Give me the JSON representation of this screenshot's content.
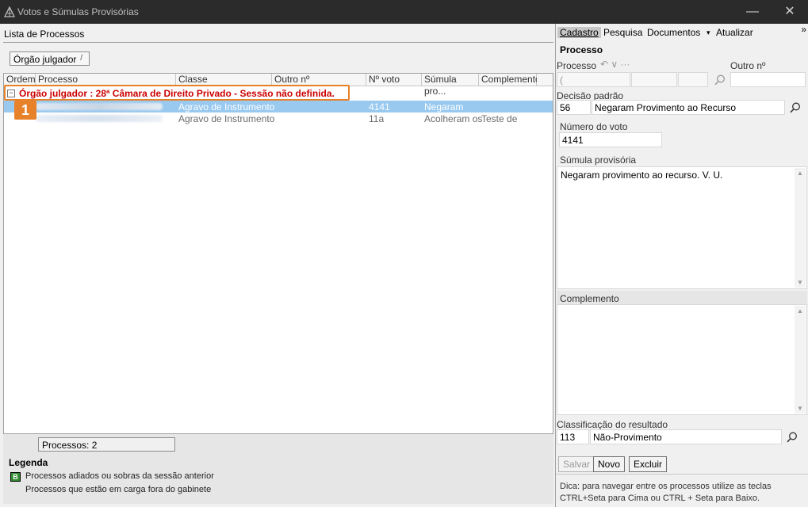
{
  "window": {
    "title": "Votos e Súmulas Provisórias",
    "minimize": "—",
    "close": "✕"
  },
  "left": {
    "panel_title": "Lista de Processos",
    "group_chip": "Órgão julgador",
    "group_chip_mark": "/",
    "columns": [
      "Ordem",
      "Processo",
      "Classe",
      "Outro nº",
      "Nº voto",
      "Súmula pro...",
      "Complemento"
    ],
    "group_toggle": "−",
    "group_label": "Órgão julgador : 28ª Câmara de Direito Privado - Sessão não definida.",
    "badge": "1",
    "rows": [
      {
        "classe": "Agravo de Instrumento",
        "voto": "4141",
        "sumula": "Negaram",
        "complemento": ""
      },
      {
        "classe": "Agravo de Instrumento",
        "voto": "11a",
        "sumula": "Acolheram os",
        "complemento": "Teste de"
      }
    ],
    "count": "Processos: 2",
    "legend": {
      "title": "Legenda",
      "icon_letter": "B",
      "item1": "Processos adiados ou sobras da sessão anterior",
      "item2": "Processos que estão em carga fora do gabinete"
    }
  },
  "right": {
    "menu": {
      "cadastro": "Cadastro",
      "pesquisa": "Pesquisa",
      "documentos": "Documentos",
      "documentos_arrow": "▾",
      "atualizar": "Atualizar",
      "more": "»"
    },
    "section_title": "Processo",
    "processo_label": "Processo",
    "processo_nav": "↶ ∨ ···",
    "processo_value": "(",
    "outro_label": "Outro nº",
    "decisao_label": "Decisão padrão",
    "decisao_code": "56",
    "decisao_text": "Negaram Provimento ao Recurso",
    "voto_label": "Número do voto",
    "voto_value": "4141",
    "sumula_label": "Súmula provisória",
    "sumula_value": "Negaram provimento ao recurso. V. U.",
    "complemento_label": "Complemento",
    "complemento_value": "",
    "classificacao_label": "Classificação do resultado",
    "classificacao_code": "113",
    "classificacao_text": "Não-Provimento",
    "buttons": {
      "salvar": "Salvar",
      "novo": "Novo",
      "excluir": "Excluir"
    },
    "hint": "Dica: para navegar entre os processos utilize as teclas CTRL+Seta para Cima ou CTRL + Seta para Baixo."
  },
  "colors": {
    "group_text": "#cc0000",
    "highlight": "#e8822a",
    "selection": "#99c9ef",
    "titlebar": "#2b2b2b"
  }
}
